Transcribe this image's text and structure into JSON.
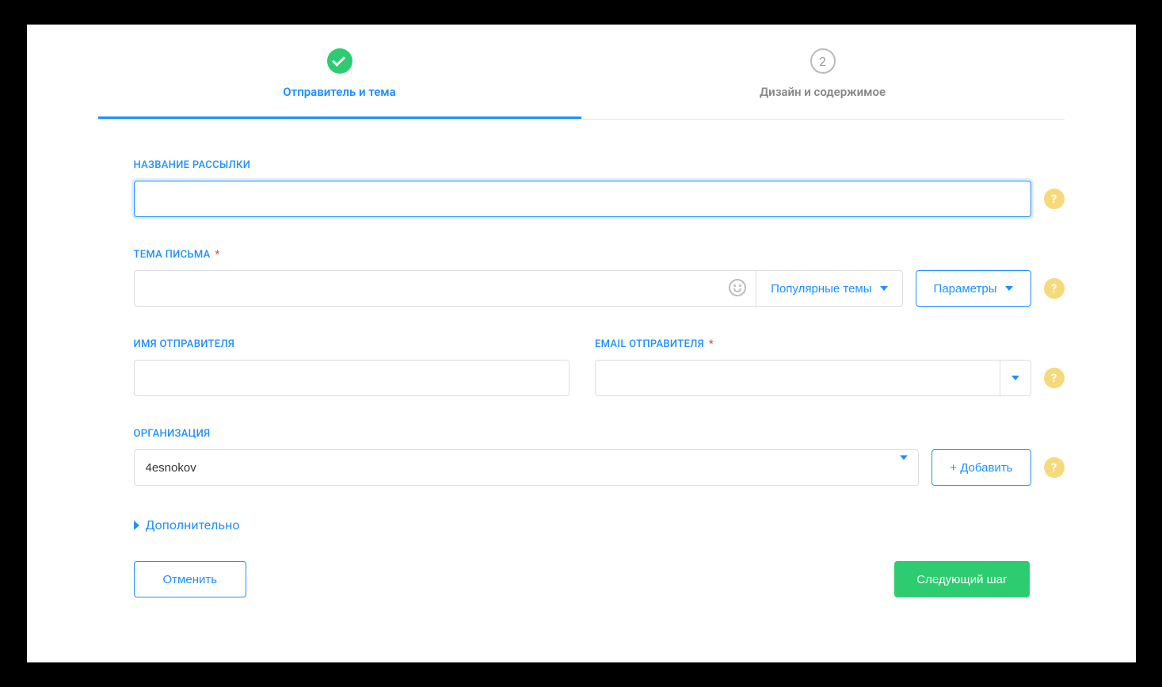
{
  "steps": {
    "step1_label": "Отправитель и тема",
    "step2_num": "2",
    "step2_label": "Дизайн и содержимое"
  },
  "labels": {
    "campaign_name": "НАЗВАНИЕ РАССЫЛКИ",
    "subject": "ТЕМА ПИСЬМА",
    "sender_name": "ИМЯ ОТПРАВИТЕЛЯ",
    "sender_email": "EMAIL ОТПРАВИТЕЛЯ",
    "organization": "ОРГАНИЗАЦИЯ"
  },
  "buttons": {
    "popular_topics": "Популярные темы",
    "parameters": "Параметры",
    "add": "+ Добавить",
    "more": "Дополнительно",
    "cancel": "Отменить",
    "next": "Следующий шаг"
  },
  "values": {
    "campaign_name": "",
    "subject": "",
    "sender_name": "",
    "sender_email": "",
    "organization": "4esnokov"
  },
  "help": "?",
  "req": "*"
}
